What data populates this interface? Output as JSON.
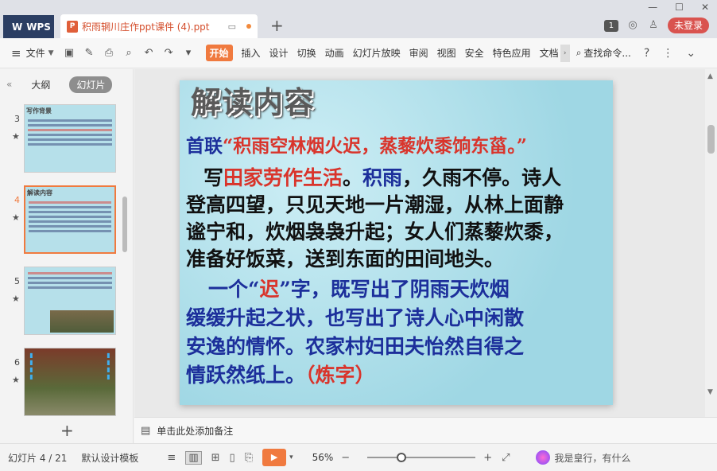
{
  "title_bar": {
    "app_name": "WPS",
    "doc_tab_label": "积雨辋川庄作ppt课件 (4).ppt",
    "doc_icon_letter": "P",
    "badge_number": "1",
    "login_button": "未登录"
  },
  "toolbar": {
    "file_label": "文件",
    "menus": [
      "开始",
      "插入",
      "设计",
      "切换",
      "动画",
      "幻灯片放映",
      "审阅",
      "视图",
      "安全",
      "特色应用",
      "文档"
    ],
    "active_menu": "开始",
    "search_label": "查找命令..."
  },
  "left_panel": {
    "tab_outline": "大纲",
    "tab_slides": "幻灯片",
    "slides": [
      {
        "number": "3",
        "title": "写作背景"
      },
      {
        "number": "4",
        "title": "解读内容",
        "selected": true
      },
      {
        "number": "5",
        "title": ""
      },
      {
        "number": "6",
        "title": ""
      }
    ]
  },
  "slide": {
    "title": "解读内容",
    "line1_prefix": "首联",
    "line1_quote": "“积雨空林烟火迟，蒸藜炊黍饷东菑。”",
    "para1_line1_a": "写",
    "para1_line1_b": "田家劳作生活",
    "para1_line1_c": "。",
    "para1_line1_d": "积雨",
    "para1_line1_e": "，久雨不停。诗人",
    "para1_line2": "登高四望，只见天地一片潮湿，从林上面静",
    "para1_line3": "谧宁和，炊烟袅袅升起；女人们蒸藜炊黍，",
    "para1_line4": "准备好饭菜，送到东面的田间地头。",
    "para2_line1_a": "一个“",
    "para2_line1_b": "迟",
    "para2_line1_c": "”字，既写出了阴雨天炊烟",
    "para2_line2": "缓缓升起之状，也写出了诗人心中闲散",
    "para2_line3": "安逸的情怀。农家村妇田夫怡然自得之",
    "para2_line4_a": "情跃然纸上。",
    "para2_line4_b": "（炼字）"
  },
  "notes": {
    "placeholder": "单击此处添加备注"
  },
  "status_bar": {
    "slide_counter": "幻灯片 4 / 21",
    "template": "默认设计模板",
    "zoom": "56%",
    "zoom_level": 0.3,
    "ai_text": "我是皇行，有什么"
  },
  "colors": {
    "accent": "#f07a3f",
    "login_red": "#d9534f",
    "wps_tab": "#2b3e63",
    "slide_red": "#d9342b",
    "slide_blue": "#1c2f9b"
  }
}
